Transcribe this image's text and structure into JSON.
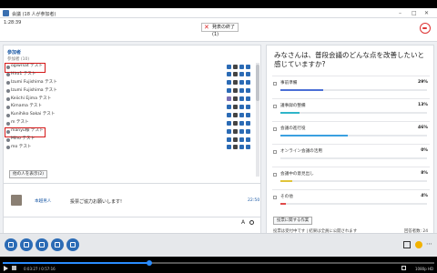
{
  "window": {
    "title": "会議 (18 人が参加者)",
    "timer": "1:28:39",
    "exit_label": "発表の終了(1)"
  },
  "participants": {
    "heading": "参加者",
    "count": "参加者 (10)",
    "items": [
      {
        "name": "ogiwrsat テスト",
        "highlighted": true
      },
      {
        "name": "Hiro1 テスト",
        "highlighted": false
      },
      {
        "name": "Izumi Fujishima テスト",
        "highlighted": false
      },
      {
        "name": "Izumi Fujishima テスト",
        "highlighted": false
      },
      {
        "name": "Keiichi Ejima テスト",
        "highlighted": false
      },
      {
        "name": "Kimama テスト",
        "highlighted": false
      },
      {
        "name": "Kunihiko Sakai テスト",
        "highlighted": false
      },
      {
        "name": "m テスト",
        "highlighted": false
      },
      {
        "name": "manyu様 テスト",
        "highlighted": true
      },
      {
        "name": "Miho テスト",
        "highlighted": false
      },
      {
        "name": "mo テスト",
        "highlighted": false
      }
    ],
    "show_all_label": "他の人を表示(2)"
  },
  "chat": {
    "sender": "本越男人",
    "message": "投票ご協力お願いします!",
    "time": "22:50",
    "font_icon": "A"
  },
  "poll": {
    "question": "みなさんは、普段会議のどんな点を改善したいと感じていますか?",
    "options": [
      {
        "label": "事前準備",
        "percent": "29%",
        "fraction": 0.29,
        "color": "#4b6fd6"
      },
      {
        "label": "議事録の整備",
        "percent": "13%",
        "fraction": 0.13,
        "color": "#2fb5c9"
      },
      {
        "label": "会議の進行役",
        "percent": "46%",
        "fraction": 0.46,
        "color": "#3aa0e0"
      },
      {
        "label": "オンライン会議の活用",
        "percent": "0%",
        "fraction": 0.0,
        "color": "#7dbb3c"
      },
      {
        "label": "会議中の意見出し",
        "percent": "8%",
        "fraction": 0.08,
        "color": "#e0c43a"
      },
      {
        "label": "その他",
        "percent": "4%",
        "fraction": 0.04,
        "color": "#e04a4a"
      }
    ],
    "results_button": "投票に関する作業",
    "footer_left": "投票は受付中です | 結果は全員に公開されます",
    "footer_right": "回答者数: 24"
  },
  "player": {
    "time": "0:03:27 / 0:57:16",
    "progress": 0.34,
    "quality": "1080p HD"
  },
  "colors": {
    "accent": "#2b6bb5",
    "highlight": "#d41818",
    "end_call": "#d33333"
  }
}
